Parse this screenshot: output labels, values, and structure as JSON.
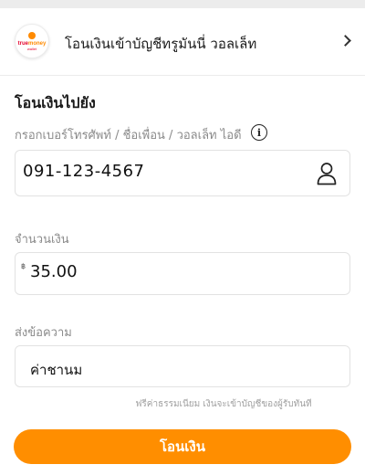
{
  "recipient_account": {
    "logo": {
      "line1_part1": "true",
      "line1_part2": "money",
      "line2": "wallet"
    },
    "name": "โอนเงินเข้าบัญชีทรูมันนี่ วอลเล็ท",
    "chevron_icon": "chevron-right-icon"
  },
  "form": {
    "section_title": "โอนเงินไปยัง",
    "recipient_label": "กรอกเบอร์โทรศัพท์ / ชื่อเพื่อน / วอลเล็ท ไอดี",
    "info_icon": "info-icon",
    "info_glyph": "i",
    "phone_value": "091-123-4567",
    "contact_icon": "person-icon",
    "amount_label": "จำนวนเงิน",
    "currency_symbol": "฿",
    "amount_value": "35.00",
    "message_label": "ส่งข้อความ",
    "message_value": "ค่าชานม"
  },
  "footnote": "ฟรีค่าธรรมเนียม เงินจะเข้าบัญชีของผู้รับทันที",
  "submit_label": "โอนเงิน",
  "colors": {
    "accent": "#ff8e00",
    "brand_red": "#e4002b",
    "label_gray": "#8a8a8a"
  }
}
